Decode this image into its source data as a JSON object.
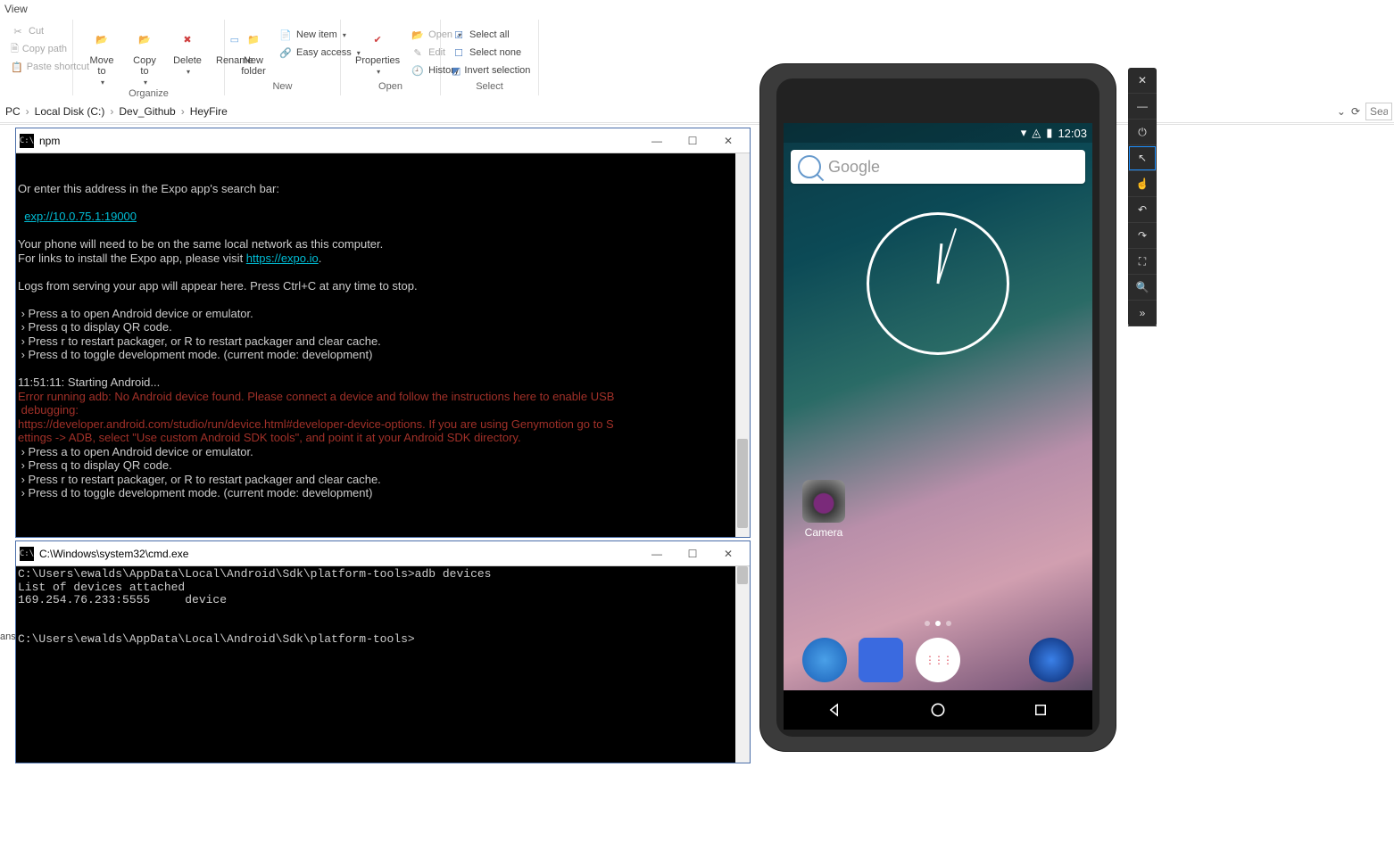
{
  "ribbon": {
    "tab": "View",
    "clipboard": {
      "cut": "Cut",
      "copy_path": "Copy path",
      "paste_shortcut": "Paste shortcut"
    },
    "organize": {
      "move_to": "Move\nto",
      "copy_to": "Copy\nto",
      "delete": "Delete",
      "rename": "Rename",
      "label": "Organize"
    },
    "new": {
      "new_item": "New item",
      "easy_access": "Easy access",
      "new_folder": "New\nfolder",
      "label": "New"
    },
    "open": {
      "open": "Open",
      "edit": "Edit",
      "history": "History",
      "properties": "Properties",
      "label": "Open"
    },
    "select": {
      "select_all": "Select all",
      "select_none": "Select none",
      "invert": "Invert selection",
      "label": "Select"
    }
  },
  "breadcrumb": {
    "items": [
      "PC",
      "Local Disk (C:)",
      "Dev_Github",
      "HeyFire"
    ]
  },
  "addr": {
    "dropdown_caret": "⌄",
    "refresh": "⟳",
    "search_placeholder": "Sea"
  },
  "truncated_label": "ans",
  "term1": {
    "title": "npm",
    "lines_pre": "\n\nOr enter this address in the Expo app's search bar:\n\n  ",
    "link1": "exp://10.0.75.1:19000",
    "lines_mid1": "\n\nYour phone will need to be on the same local network as this computer.\nFor links to install the Expo app, please visit ",
    "link2": "https://expo.io",
    "lines_mid2": ".\n\nLogs from serving your app will appear here. Press Ctrl+C at any time to stop.\n\n › Press a to open Android device or emulator.\n › Press q to display QR code.\n › Press r to restart packager, or R to restart packager and clear cache.\n › Press d to toggle development mode. (current mode: development)\n\n11:51:11: Starting Android...\n",
    "err": "Error running adb: No Android device found. Please connect a device and follow the instructions here to enable USB\n debugging:\nhttps://developer.android.com/studio/run/device.html#developer-device-options. If you are using Genymotion go to S\nettings -> ADB, select \"Use custom Android SDK tools\", and point it at your Android SDK directory.",
    "lines_post": "\n › Press a to open Android device or emulator.\n › Press q to display QR code.\n › Press r to restart packager, or R to restart packager and clear cache.\n › Press d to toggle development mode. (current mode: development)\n"
  },
  "term2": {
    "title": "C:\\Windows\\system32\\cmd.exe",
    "body": "C:\\Users\\ewalds\\AppData\\Local\\Android\\Sdk\\platform-tools>adb devices\nList of devices attached\n169.254.76.233:5555     device\n\n\nC:\\Users\\ewalds\\AppData\\Local\\Android\\Sdk\\platform-tools>"
  },
  "emulator": {
    "status_time": "12:03",
    "search_placeholder": "Google",
    "camera_label": "Camera"
  },
  "emu_toolbar": {
    "close": "✕",
    "minimize": "—",
    "power": "⏻",
    "pointer": "↖",
    "touch": "☝",
    "rotate_left": "↶",
    "rotate_right": "↷",
    "fit": "⛶",
    "zoom": "🔍",
    "more": "»"
  }
}
